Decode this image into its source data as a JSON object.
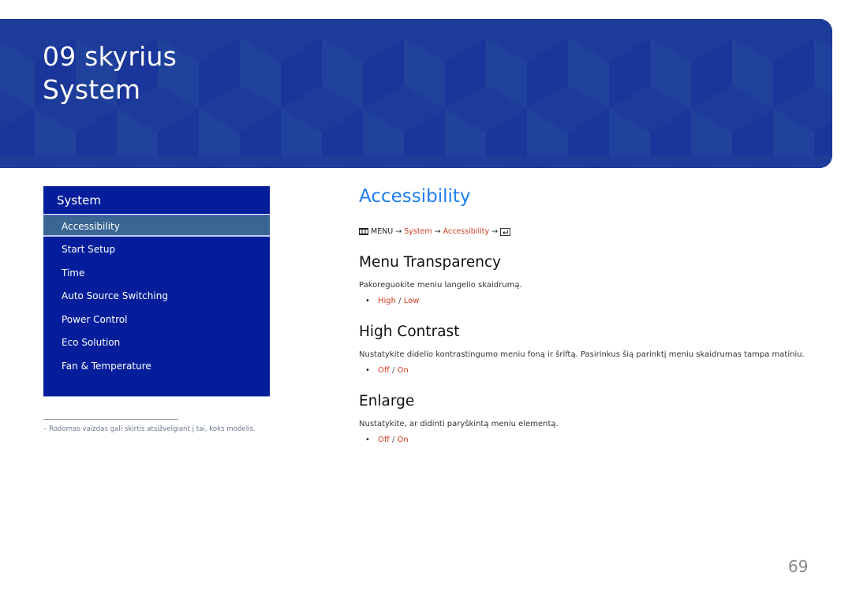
{
  "banner": {
    "chapter_number": "09 skyrius",
    "chapter_title": "System",
    "colors": {
      "base": "#1e3d9b",
      "face_light": "#20429c",
      "face_dark": "#1a369a"
    }
  },
  "sidebar": {
    "title": "System",
    "items": [
      {
        "label": "Accessibility",
        "active": true
      },
      {
        "label": "Start Setup"
      },
      {
        "label": "Time"
      },
      {
        "label": "Auto Source Switching"
      },
      {
        "label": "Power Control"
      },
      {
        "label": "Eco Solution"
      },
      {
        "label": "Fan & Temperature"
      }
    ],
    "colors": {
      "background": "#041e9b",
      "active": "#3a6694"
    }
  },
  "footnote": "–  Rodomas vaizdas gali skirtis atsižvelgiant į tai, koks modelis.",
  "main": {
    "title": "Accessibility",
    "menu_path": {
      "menu_icon": "menu-icon",
      "menu_label": "MENU",
      "arrow": "→",
      "step1": "System",
      "step2": "Accessibility",
      "end_icon": "enter-icon"
    },
    "sections": [
      {
        "title": "Menu Transparency",
        "description": "Pakoreguokite meniu langelio skaidrumą.",
        "option_a": "High",
        "separator": " / ",
        "option_b": "Low"
      },
      {
        "title": "High Contrast",
        "description": "Nustatykite didelio kontrastingumo meniu foną ir šriftą. Pasirinkus šią parinktį meniu skaidrumas tampa matiniu.",
        "option_a": "Off",
        "separator": " / ",
        "option_b": "On"
      },
      {
        "title": "Enlarge",
        "description": "Nustatykite, ar didinti paryškintą meniu elementą.",
        "option_a": "Off",
        "separator": " / ",
        "option_b": "On"
      }
    ],
    "bullet": "•",
    "colors": {
      "title": "#1f7ef0",
      "highlight": "#d23a1c"
    }
  },
  "page_number": "69"
}
